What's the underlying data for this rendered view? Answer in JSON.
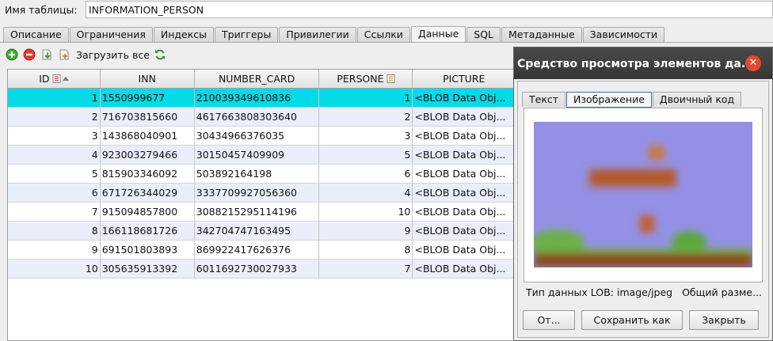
{
  "table_name": {
    "label": "Имя таблицы:",
    "value": "INFORMATION_PERSON"
  },
  "tabs": [
    {
      "label": "Описание"
    },
    {
      "label": "Ограничения"
    },
    {
      "label": "Индексы"
    },
    {
      "label": "Триггеры"
    },
    {
      "label": "Привилегии"
    },
    {
      "label": "Ссылки"
    },
    {
      "label": "Данные",
      "active": true
    },
    {
      "label": "SQL"
    },
    {
      "label": "Метаданные"
    },
    {
      "label": "Зависимости"
    }
  ],
  "toolbar": {
    "icons": [
      "add-icon",
      "delete-icon",
      "export-icon",
      "import-icon",
      "refresh-icon"
    ],
    "load_all_label": "Загрузить все"
  },
  "grid": {
    "columns": [
      "ID",
      "INN",
      "NUMBER_CARD",
      "PERSONE",
      "PICTURE"
    ],
    "rows": [
      [
        "1",
        "1550999677",
        "210039349610836",
        "1",
        "<BLOB Data Obj..."
      ],
      [
        "2",
        "716703815660",
        "4617663808303640",
        "2",
        "<BLOB Data Obj..."
      ],
      [
        "3",
        "143868040901",
        "30434966376035",
        "3",
        "<BLOB Data Obj..."
      ],
      [
        "4",
        "923003279466",
        "30150457409909",
        "5",
        "<BLOB Data Obj..."
      ],
      [
        "5",
        "815903346092",
        "503892164198",
        "6",
        "<BLOB Data Obj..."
      ],
      [
        "6",
        "671726344029",
        "3337709927056360",
        "4",
        "<BLOB Data Obj..."
      ],
      [
        "7",
        "915094857800",
        "3088215295114196",
        "10",
        "<BLOB Data Obj..."
      ],
      [
        "8",
        "166118681726",
        "342704747163495",
        "9",
        "<BLOB Data Obj..."
      ],
      [
        "9",
        "691501803893",
        "869922417626376",
        "8",
        "<BLOB Data Obj..."
      ],
      [
        "10",
        "305635913392",
        "6011692730027933",
        "7",
        "<BLOB Data Obj..."
      ]
    ],
    "selected_row": 0
  },
  "dialog": {
    "title": "Средство просмотра элементов да...",
    "tabs": [
      {
        "label": "Текст"
      },
      {
        "label": "Изображение",
        "active": true
      },
      {
        "label": "Двоичный код"
      }
    ],
    "lob_type": "Тип данных LOB: image/jpeg",
    "total_size": "Общий разме...",
    "buttons": {
      "open": "От...",
      "save_as": "Сохранить как",
      "close": "Закрыть"
    }
  },
  "colors": {
    "selection": "#00dbe7",
    "alt_row": "#eaeefa",
    "dialog_title": "#3c3c3c",
    "close_button": "#e2492f"
  }
}
